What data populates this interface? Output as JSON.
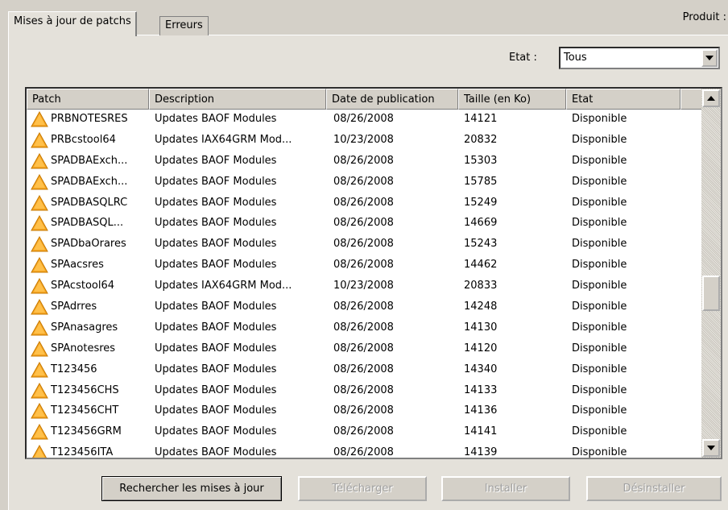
{
  "tabs": [
    {
      "label": "Mises à jour de patchs"
    },
    {
      "label": "Erreurs"
    }
  ],
  "product_label": "Produit :",
  "filter": {
    "label": "Etat :",
    "value": "Tous"
  },
  "table": {
    "columns": [
      "Patch",
      "Description",
      "Date de publication",
      "Taille (en Ko)",
      "Etat"
    ],
    "rows": [
      [
        "PRBNOTESRES",
        "Updates BAOF Modules",
        "08/26/2008",
        "14121",
        "Disponible"
      ],
      [
        "PRBcstool64",
        "Updates IAX64GRM Mod...",
        "10/23/2008",
        "20832",
        "Disponible"
      ],
      [
        "SPADBAExch...",
        "Updates BAOF Modules",
        "08/26/2008",
        "15303",
        "Disponible"
      ],
      [
        "SPADBAExch...",
        "Updates BAOF Modules",
        "08/26/2008",
        "15785",
        "Disponible"
      ],
      [
        "SPADBASQLRC",
        "Updates BAOF Modules",
        "08/26/2008",
        "15249",
        "Disponible"
      ],
      [
        "SPADBASQL...",
        "Updates BAOF Modules",
        "08/26/2008",
        "14669",
        "Disponible"
      ],
      [
        "SPADbaOrares",
        "Updates BAOF Modules",
        "08/26/2008",
        "15243",
        "Disponible"
      ],
      [
        "SPAacsres",
        "Updates BAOF Modules",
        "08/26/2008",
        "14462",
        "Disponible"
      ],
      [
        "SPAcstool64",
        "Updates IAX64GRM Mod...",
        "10/23/2008",
        "20833",
        "Disponible"
      ],
      [
        "SPAdrres",
        "Updates BAOF Modules",
        "08/26/2008",
        "14248",
        "Disponible"
      ],
      [
        "SPAnasagres",
        "Updates BAOF Modules",
        "08/26/2008",
        "14130",
        "Disponible"
      ],
      [
        "SPAnotesres",
        "Updates BAOF Modules",
        "08/26/2008",
        "14120",
        "Disponible"
      ],
      [
        "T123456",
        "Updates BAOF Modules",
        "08/26/2008",
        "14340",
        "Disponible"
      ],
      [
        "T123456CHS",
        "Updates BAOF Modules",
        "08/26/2008",
        "14133",
        "Disponible"
      ],
      [
        "T123456CHT",
        "Updates BAOF Modules",
        "08/26/2008",
        "14136",
        "Disponible"
      ],
      [
        "T123456GRM",
        "Updates BAOF Modules",
        "08/26/2008",
        "14141",
        "Disponible"
      ],
      [
        "T123456ITA",
        "Updates BAOF Modules",
        "08/26/2008",
        "14139",
        "Disponible"
      ]
    ],
    "row_icon": "warning-icon"
  },
  "buttons": {
    "search": "Rechercher les mises à jour",
    "download": "Télécharger",
    "install": "Installer",
    "uninstall": "Désinstaller"
  },
  "colors": {
    "warning": "#f5a623",
    "disabled_text": "#a0a0a0"
  }
}
